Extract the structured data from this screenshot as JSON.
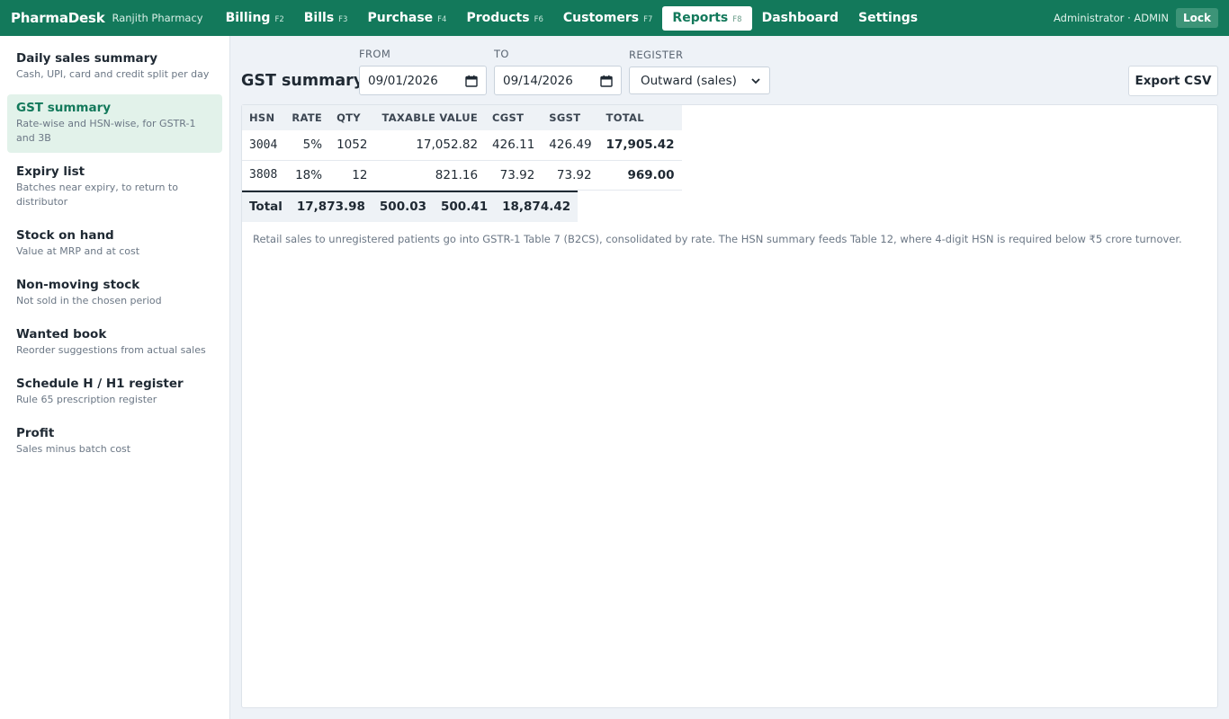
{
  "app": {
    "name": "PharmaDesk",
    "store": "Ranjith Pharmacy"
  },
  "nav": [
    {
      "label": "Billing",
      "key": "F2"
    },
    {
      "label": "Bills",
      "key": "F3"
    },
    {
      "label": "Purchase",
      "key": "F4"
    },
    {
      "label": "Products",
      "key": "F6"
    },
    {
      "label": "Customers",
      "key": "F7"
    },
    {
      "label": "Reports",
      "key": "F8",
      "active": true
    },
    {
      "label": "Dashboard",
      "key": ""
    },
    {
      "label": "Settings",
      "key": ""
    }
  ],
  "user": "Administrator · ADMIN",
  "lock_label": "Lock",
  "sidebar": [
    {
      "title": "Daily sales summary",
      "desc": "Cash, UPI, card and credit split per day"
    },
    {
      "title": "GST summary",
      "desc": "Rate-wise and HSN-wise, for GSTR-1 and 3B",
      "active": true
    },
    {
      "title": "Expiry list",
      "desc": "Batches near expiry, to return to distributor"
    },
    {
      "title": "Stock on hand",
      "desc": "Value at MRP and at cost"
    },
    {
      "title": "Non-moving stock",
      "desc": "Not sold in the chosen period"
    },
    {
      "title": "Wanted book",
      "desc": "Reorder suggestions from actual sales"
    },
    {
      "title": "Schedule H / H1 register",
      "desc": "Rule 65 prescription register"
    },
    {
      "title": "Profit",
      "desc": "Sales minus batch cost"
    }
  ],
  "page": {
    "title": "GST summary",
    "from_label": "FROM",
    "from_value": "09/01/2026",
    "to_label": "TO",
    "to_value": "09/14/2026",
    "register_label": "REGISTER",
    "register_value": "Outward (sales)",
    "export_label": "Export CSV"
  },
  "table": {
    "headers": [
      "HSN",
      "RATE",
      "QTY",
      "TAXABLE VALUE",
      "CGST",
      "SGST",
      "TOTAL"
    ],
    "rows": [
      [
        "3004",
        "5%",
        "1052",
        "17,052.82",
        "426.11",
        "426.49",
        "17,905.42"
      ],
      [
        "3808",
        "18%",
        "12",
        "821.16",
        "73.92",
        "73.92",
        "969.00"
      ]
    ],
    "total": [
      "Total",
      "17,873.98",
      "500.03",
      "500.41",
      "18,874.42"
    ]
  },
  "note": "Retail sales to unregistered patients go into GSTR-1 Table 7 (B2CS), consolidated by rate. The HSN summary feeds Table 12, where 4-digit HSN is required below ₹5 crore turnover.",
  "colors": {
    "brand": "#13795b",
    "active_bg": "#e2f2ea"
  }
}
